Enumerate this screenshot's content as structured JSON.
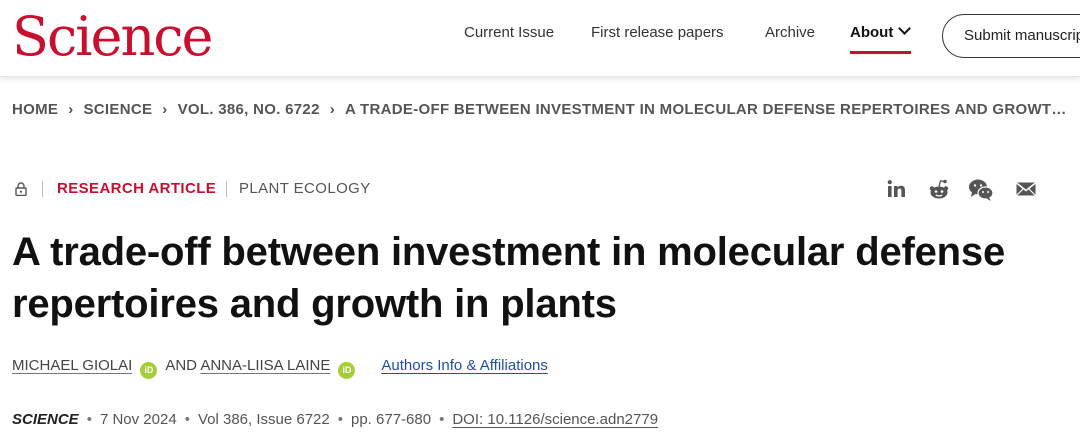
{
  "header": {
    "logo": "Science",
    "nav": {
      "current_issue": "Current Issue",
      "first_release": "First release papers",
      "archive": "Archive",
      "about": "About"
    },
    "submit": "Submit manuscript",
    "accent_color": "#c8102e"
  },
  "breadcrumb": {
    "home": "HOME",
    "science": "SCIENCE",
    "volume": "VOL. 386, NO. 6722",
    "article": "A TRADE-OFF BETWEEN INVESTMENT IN MOLECULAR DEFENSE REPERTOIRES AND GROWT…"
  },
  "article": {
    "type": "RESEARCH ARTICLE",
    "subject": "PLANT ECOLOGY",
    "title": "A trade-off between investment in molecular defense repertoires and growth in plants",
    "authors": {
      "author1": "MICHAEL GIOLAI",
      "and": "AND",
      "author2": "ANNA-LIISA LAINE",
      "orcid_label": "iD",
      "affiliations_link": "Authors Info & Affiliations"
    },
    "citation": {
      "journal": "SCIENCE",
      "date": "7 Nov 2024",
      "volume_issue": "Vol 386, Issue 6722",
      "pages": "pp. 677-680",
      "doi": "DOI: 10.1126/science.adn2779",
      "separator": "•"
    }
  },
  "share_icons": [
    "linkedin-icon",
    "reddit-icon",
    "wechat-icon",
    "email-icon"
  ]
}
